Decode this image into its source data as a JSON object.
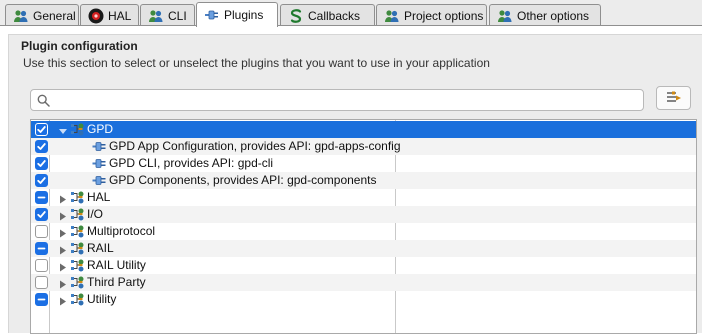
{
  "tabs": [
    {
      "label": "General",
      "icon": "people-icon",
      "active": false
    },
    {
      "label": "HAL",
      "icon": "hal-chip-icon",
      "active": false
    },
    {
      "label": "CLI",
      "icon": "people-icon",
      "active": false
    },
    {
      "label": "Plugins",
      "icon": "plugin-connector-icon",
      "active": true
    },
    {
      "label": "Callbacks",
      "icon": "callback-s-icon",
      "active": false
    },
    {
      "label": "Project options",
      "icon": "people-icon",
      "active": false
    },
    {
      "label": "Other options",
      "icon": "people-icon",
      "active": false
    }
  ],
  "section": {
    "title": "Plugin configuration",
    "description": "Use this section to select or unselect the plugins that you want to use in your application"
  },
  "search": {
    "value": "",
    "placeholder": ""
  },
  "tree": {
    "rows": [
      {
        "label": "GPD",
        "state": "checked",
        "kind": "category",
        "expander": "expanded",
        "level": 0,
        "selected": true
      },
      {
        "label": "GPD App Configuration, provides API: gpd-apps-config",
        "state": "checked",
        "kind": "plugin",
        "level": 1
      },
      {
        "label": "GPD CLI, provides API: gpd-cli",
        "state": "checked",
        "kind": "plugin",
        "level": 1
      },
      {
        "label": "GPD Components, provides API: gpd-components",
        "state": "checked",
        "kind": "plugin",
        "level": 1
      },
      {
        "label": "HAL",
        "state": "mixed",
        "kind": "category",
        "expander": "collapsed",
        "level": 0
      },
      {
        "label": "I/O",
        "state": "checked",
        "kind": "category",
        "expander": "collapsed",
        "level": 0
      },
      {
        "label": "Multiprotocol",
        "state": "unchecked",
        "kind": "category",
        "expander": "collapsed",
        "level": 0
      },
      {
        "label": "RAIL",
        "state": "mixed",
        "kind": "category",
        "expander": "collapsed",
        "level": 0
      },
      {
        "label": "RAIL Utility",
        "state": "unchecked",
        "kind": "category",
        "expander": "collapsed",
        "level": 0
      },
      {
        "label": "Third Party",
        "state": "unchecked",
        "kind": "category",
        "expander": "collapsed",
        "level": 0
      },
      {
        "label": "Utility",
        "state": "mixed",
        "kind": "category",
        "expander": "collapsed",
        "level": 0
      }
    ]
  },
  "colors": {
    "selection": "#1a6fdc",
    "checkbox": "#1b6fe4",
    "panel": "#ececec"
  }
}
